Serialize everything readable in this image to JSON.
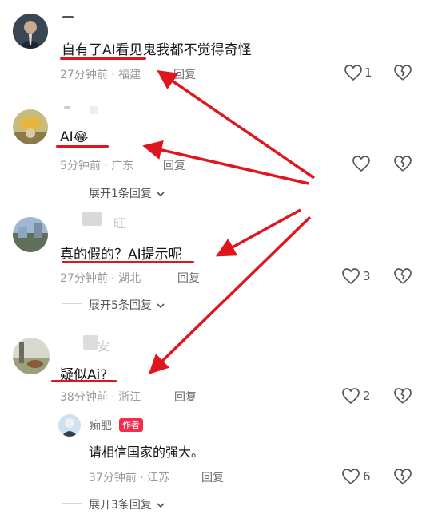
{
  "comments": [
    {
      "text": "自有了AI看见鬼我都不觉得奇怪",
      "time": "27分钟前 · 福建",
      "reply": "回复",
      "likes": "1"
    },
    {
      "text": "AI",
      "emoji": "😂",
      "time": "5分钟前 · 广东",
      "reply": "回复",
      "expand": "展开1条回复"
    },
    {
      "username": "旺",
      "text": "真的假的？AI提示呢",
      "time": "27分钟前 · 湖北",
      "reply": "回复",
      "likes": "3",
      "expand": "展开5条回复"
    },
    {
      "username": "安",
      "text": "疑似Ai?",
      "time": "38分钟前 · 浙江",
      "reply": "回复",
      "likes": "2"
    }
  ],
  "reply": {
    "username": "痴肥",
    "author_tag": "作者",
    "text": "请相信国家的强大。",
    "time": "37分钟前 · 江苏",
    "reply": "回复",
    "likes": "6",
    "expand": "展开3条回复"
  },
  "colors": {
    "annotation_red": "#e0161e",
    "author_tag": "#f12c4e"
  },
  "icons": [
    "heart-icon",
    "dislike-heart-icon",
    "chevron-down-icon"
  ]
}
